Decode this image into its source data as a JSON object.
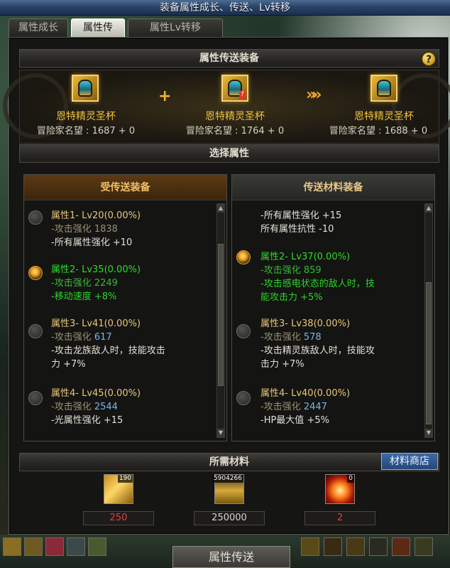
{
  "window_title": "装备属性成长、传送、Lv转移",
  "tabs": [
    {
      "label": "属性成长",
      "active": false
    },
    {
      "label": "属性传送",
      "active": true
    },
    {
      "label": "属性Lv转移",
      "active": false
    }
  ],
  "equip_section": {
    "title": "属性传送装备",
    "items": [
      {
        "name": "恩特精灵圣杯",
        "stat_label": "冒险家名望",
        "value": "1687 + 0"
      },
      {
        "name": "恩特精灵圣杯",
        "stat_label": "冒险家名望",
        "value": "1764 + 0"
      },
      {
        "name": "恩特精灵圣杯",
        "stat_label": "冒险家名望",
        "value": "1688 + 0"
      }
    ]
  },
  "select_section": {
    "title": "选择属性"
  },
  "receive_panel": {
    "title": "受传送装备",
    "groups": [
      {
        "title": "属性1- Lv20(0.00%)",
        "selected": false,
        "lines": [
          {
            "text": "-攻击强化 ",
            "num": "1838"
          },
          {
            "text": "-所有属性强化 +10",
            "num": ""
          }
        ]
      },
      {
        "title": "属性2- Lv35(0.00%)",
        "selected": true,
        "lines": [
          {
            "text": "-攻击强化 ",
            "num": "2249"
          },
          {
            "text": "-移动速度 +8%",
            "num": ""
          }
        ]
      },
      {
        "title": "属性3- Lv41(0.00%)",
        "selected": false,
        "lines": [
          {
            "text": "-攻击强化 ",
            "num": "617"
          },
          {
            "text": "-攻击龙族敌人时，技能攻击",
            "num": ""
          },
          {
            "text": " 力 +7%",
            "num": ""
          }
        ]
      },
      {
        "title": "属性4- Lv45(0.00%)",
        "selected": false,
        "lines": [
          {
            "text": "-攻击强化 ",
            "num": "2544"
          },
          {
            "text": "-光属性强化 +15",
            "num": ""
          }
        ]
      }
    ]
  },
  "source_panel": {
    "title": "传送材料装备",
    "top_lines": [
      "-所有属性强化 +15",
      " 所有属性抗性 -10"
    ],
    "groups": [
      {
        "title": "属性2- Lv37(0.00%)",
        "selected": true,
        "lines": [
          {
            "text": "-攻击强化 ",
            "num": "859"
          },
          {
            "text": "-攻击感电状态的敌人时，技",
            "num": ""
          },
          {
            "text": " 能攻击力 +5%",
            "num": ""
          }
        ]
      },
      {
        "title": "属性3- Lv38(0.00%)",
        "selected": false,
        "lines": [
          {
            "text": "-攻击强化 ",
            "num": "578"
          },
          {
            "text": "-攻击精灵族敌人时，技能攻",
            "num": ""
          },
          {
            "text": " 击力 +7%",
            "num": ""
          }
        ]
      },
      {
        "title": "属性4- Lv40(0.00%)",
        "selected": false,
        "lines": [
          {
            "text": "-攻击强化 ",
            "num": "2447"
          },
          {
            "text": "-HP最大值 +5%",
            "num": ""
          }
        ]
      }
    ]
  },
  "materials": {
    "title": "所需材料",
    "shop_label": "材料商店",
    "items": [
      {
        "icon": "gold-crystal-icon",
        "count": "190",
        "required": "250",
        "required_color": "#e04040"
      },
      {
        "icon": "gold-bars-icon",
        "count": "5904266",
        "required": "250000",
        "required_color": "#d8d8d0"
      },
      {
        "icon": "fire-orb-icon",
        "count": "0",
        "required": "2",
        "required_color": "#e04040"
      }
    ]
  },
  "transfer_button_label": "属性传送"
}
